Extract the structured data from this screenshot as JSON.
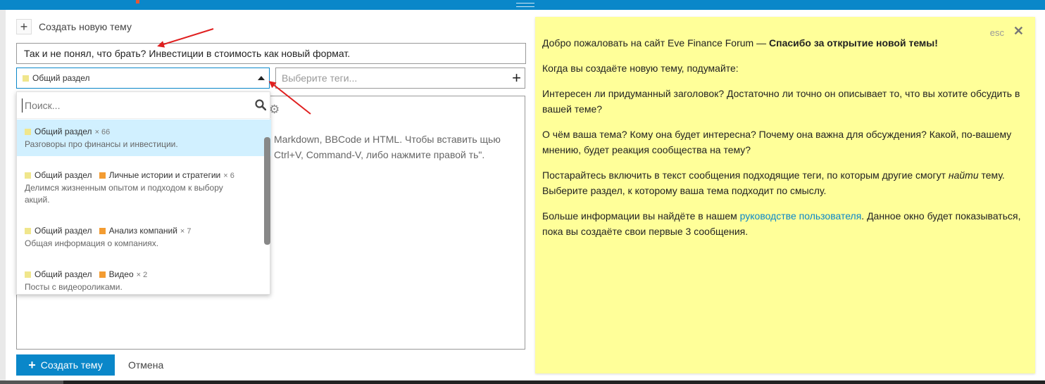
{
  "composer": {
    "header_label": "Создать новую тему",
    "title_value": "Так и не понял, что брать? Инвестиции в стоимость как новый формат.",
    "category_selected": "Общий раздел",
    "tags_placeholder": "Выберите теги...",
    "editor_hint": "Markdown, BBCode и HTML. Чтобы вставить щью Ctrl+V, Command-V, либо нажмите правой ть\".",
    "create_button": "Создать тему",
    "cancel_button": "Отмена"
  },
  "dropdown": {
    "search_placeholder": "Поиск...",
    "items": [
      {
        "parent": "Общий раздел",
        "child": "",
        "count": "× 66",
        "desc": "Разговоры про финансы и инвестиции."
      },
      {
        "parent": "Общий раздел",
        "child": "Личные истории и стратегии",
        "count": "× 6",
        "desc": "Делимся жизненным опытом и подходом к выбору акций."
      },
      {
        "parent": "Общий раздел",
        "child": "Анализ компаний",
        "count": "× 7",
        "desc": "Общая информация о компаниях."
      },
      {
        "parent": "Общий раздел",
        "child": "Видео",
        "count": "× 2",
        "desc": "Посты с видеороликами."
      }
    ]
  },
  "welcome": {
    "esc": "esc",
    "close": "✕",
    "intro_prefix": "Добро пожаловать на сайт Eve Finance Forum — ",
    "intro_bold": "Спасибо за открытие новой темы!",
    "p2": "Когда вы создаёте новую тему, подумайте:",
    "p3": "Интересен ли придуманный заголовок? Достаточно ли точно он описывает то, что вы хотите обсудить в вашей теме?",
    "p4": "О чём ваша тема? Кому она будет интересна? Почему она важна для обсуждения? Какой, по-вашему мнению, будет реакция сообщества на тему?",
    "p5_a": "Постарайтесь включить в текст сообщения подходящие теги, по которым другие смогут ",
    "p5_em": "найти",
    "p5_b": " тему. Выберите раздел, к которому ваша тема подходит по смыслу.",
    "p6_a": "Больше информации вы найдёте в нашем ",
    "p6_link": "руководстве пользователя",
    "p6_b": ". Данное окно будет показываться, пока вы создаёте свои первые 3 сообщения."
  },
  "colors": {
    "accent": "#0a87c9",
    "welcome_bg": "#ffff99",
    "cat_yellow": "#f0e68c",
    "cat_orange": "#f39c32",
    "arrow": "#e02020"
  },
  "icons": {
    "plus": "plus-icon",
    "search": "search-icon",
    "gear": "gear-icon",
    "close": "close-icon"
  }
}
